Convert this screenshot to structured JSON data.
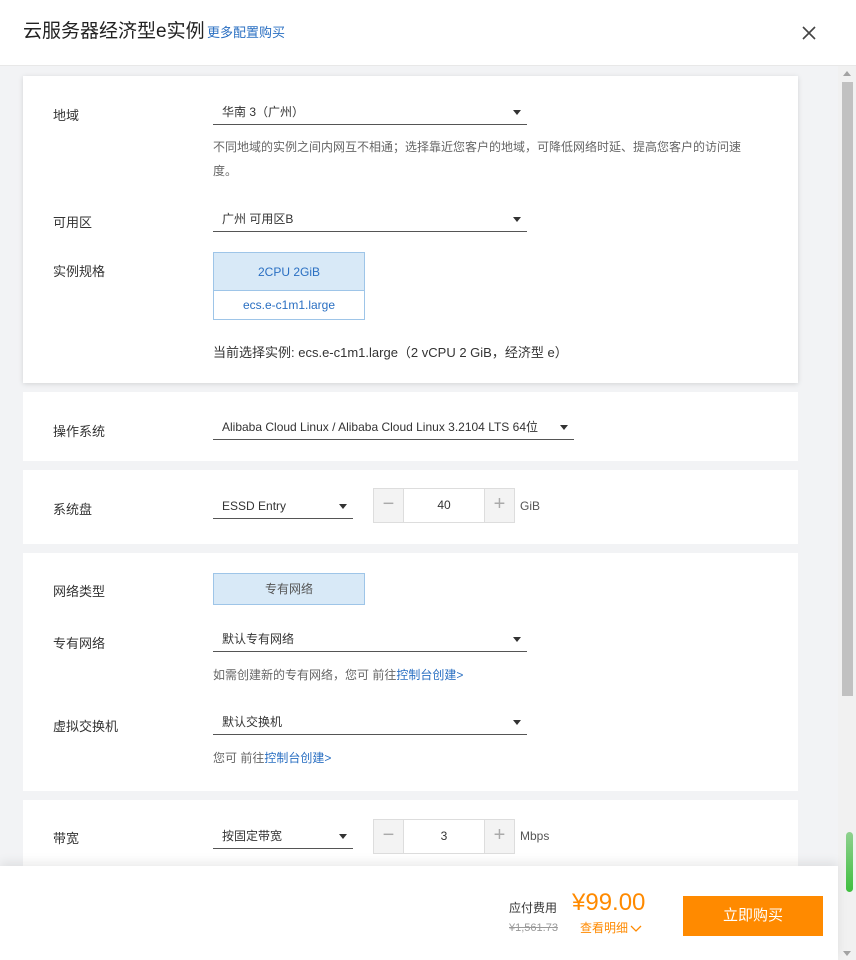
{
  "header": {
    "title": "云服务器经济型e实例",
    "more_link": "更多配置购买"
  },
  "region": {
    "label": "地域",
    "value": "华南 3（广州）",
    "hint": "不同地域的实例之间内网互不相通；选择靠近您客户的地域，可降低网络时延、提高您客户的访问速度。"
  },
  "zone": {
    "label": "可用区",
    "value": "广州 可用区B"
  },
  "spec": {
    "label": "实例规格",
    "cpu_mem": "2CPU 2GiB",
    "type": "ecs.e-c1m1.large",
    "current": "当前选择实例: ecs.e-c1m1.large（2 vCPU 2 GiB，经济型 e）"
  },
  "os": {
    "label": "操作系统",
    "value": "Alibaba Cloud Linux / Alibaba Cloud Linux 3.2104 LTS 64位"
  },
  "disk": {
    "label": "系统盘",
    "type": "ESSD Entry",
    "minus": "−",
    "size": "40",
    "plus": "+",
    "unit": "GiB"
  },
  "network": {
    "type_label": "网络类型",
    "type_value": "专有网络",
    "vpc_label": "专有网络",
    "vpc_value": "默认专有网络",
    "vpc_hint_prefix": "如需创建新的专有网络，您可 前往",
    "vpc_hint_link": "控制台创建>",
    "vswitch_label": "虚拟交换机",
    "vswitch_value": "默认交换机",
    "vswitch_hint_prefix": "您可 前往",
    "vswitch_hint_link": "控制台创建>"
  },
  "bandwidth": {
    "label": "带宽",
    "type": "按固定带宽",
    "minus": "−",
    "value": "3",
    "plus": "+",
    "unit": "Mbps"
  },
  "footer": {
    "fee_label": "应付费用",
    "price": "¥99.00",
    "original_price": "¥1,561.73",
    "details": "查看明细",
    "buy_button": "立即购买"
  },
  "colors": {
    "accent": "#ff8a00",
    "link": "#2a6fc2",
    "selected_bg": "#d8e9f7"
  }
}
